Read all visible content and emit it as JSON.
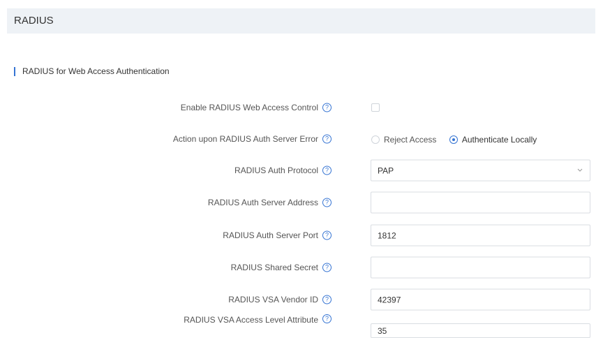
{
  "header": {
    "title": "RADIUS"
  },
  "section": {
    "title": "RADIUS for Web Access Authentication"
  },
  "help_glyph": "?",
  "fields": {
    "enable_control": {
      "label": "Enable RADIUS Web Access Control",
      "checked": false
    },
    "server_error_action": {
      "label": "Action upon RADIUS Auth Server Error",
      "options": [
        {
          "label": "Reject Access",
          "selected": false
        },
        {
          "label": "Authenticate Locally",
          "selected": true
        }
      ]
    },
    "auth_protocol": {
      "label": "RADIUS Auth Protocol",
      "value": "PAP"
    },
    "server_address": {
      "label": "RADIUS Auth Server Address",
      "value": ""
    },
    "server_port": {
      "label": "RADIUS Auth Server Port",
      "value": "1812"
    },
    "shared_secret": {
      "label": "RADIUS Shared Secret",
      "value": ""
    },
    "vsa_vendor_id": {
      "label": "RADIUS VSA Vendor ID",
      "value": "42397"
    },
    "vsa_access_level": {
      "label": "RADIUS VSA Access Level Attribute",
      "value": "35"
    }
  },
  "colors": {
    "accent": "#3574d3",
    "header_background": "#eef2f6",
    "input_border": "#d9dde2"
  }
}
